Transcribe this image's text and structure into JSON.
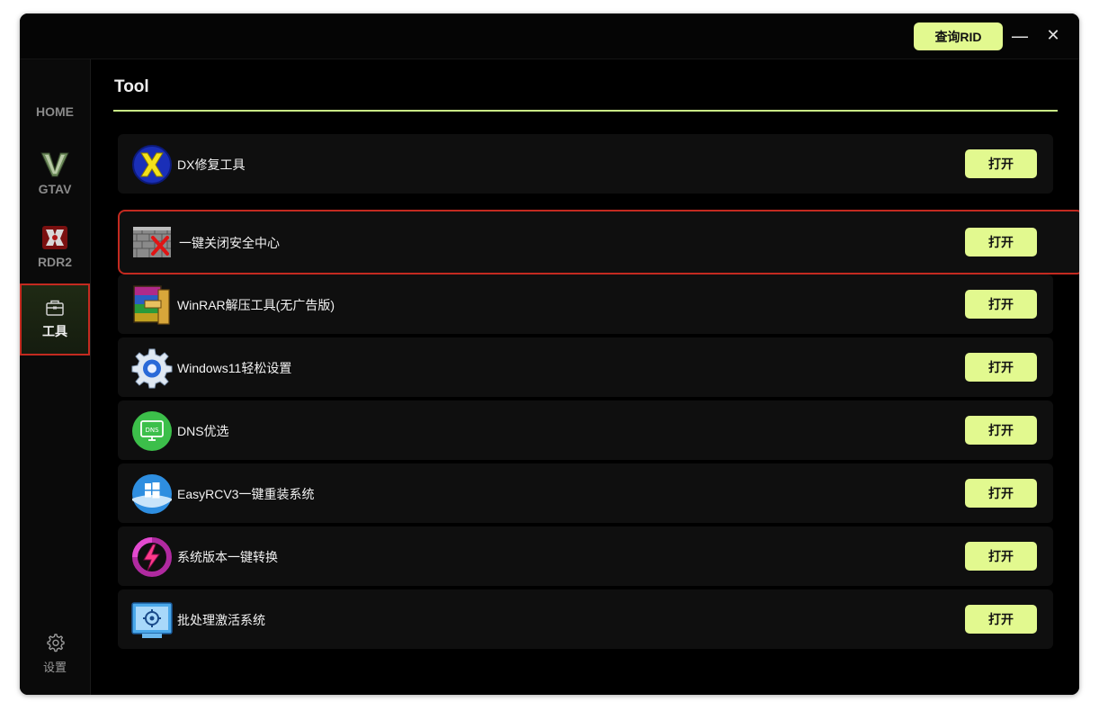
{
  "titlebar": {
    "rid_button": "查询RID",
    "minimize": "—",
    "close": "✕"
  },
  "sidebar": {
    "items": [
      {
        "label": "HOME",
        "icon": "none"
      },
      {
        "label": "GTAV",
        "icon": "gtav-logo-icon"
      },
      {
        "label": "RDR2",
        "icon": "rdr2-logo-icon"
      },
      {
        "label": "工具",
        "icon": "toolbox-icon",
        "active": true
      },
      {
        "label": "设置",
        "icon": "gear-icon"
      }
    ]
  },
  "main": {
    "title": "Tool",
    "open_label": "打开",
    "tools": [
      {
        "name": "DX修复工具",
        "icon": "dx-repair-icon"
      },
      {
        "name": "一键关闭安全中心",
        "icon": "firewall-icon",
        "selected": true
      },
      {
        "name": "WinRAR解压工具(无广告版)",
        "icon": "winrar-icon"
      },
      {
        "name": "Windows11轻松设置",
        "icon": "settings-cog-icon"
      },
      {
        "name": "DNS优选",
        "icon": "dns-icon"
      },
      {
        "name": "EasyRCV3一键重装系统",
        "icon": "windows-reinstall-icon"
      },
      {
        "name": "系统版本一键转换",
        "icon": "version-switch-icon"
      },
      {
        "name": "批处理激活系统",
        "icon": "batch-activate-icon"
      }
    ]
  },
  "colors": {
    "accent": "#e2f98f",
    "rule": "#c9ec86",
    "highlight_border": "#c32a20",
    "background": "#000000"
  }
}
